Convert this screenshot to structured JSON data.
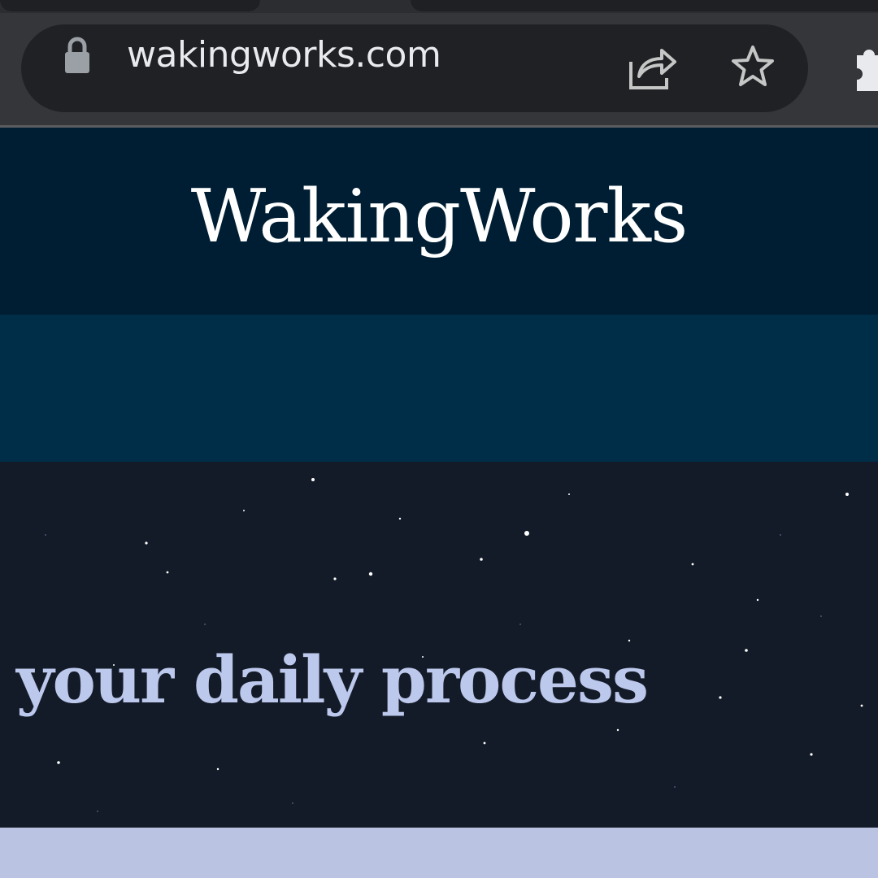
{
  "browser": {
    "address_bar": {
      "url": "wakingworks.com",
      "lock_icon": "lock-icon",
      "share_icon": "share-icon",
      "bookmark_icon": "star-icon"
    },
    "extensions_icon": "puzzle-icon"
  },
  "site": {
    "title": "WakingWorks",
    "hero_text": "your daily process"
  },
  "colors": {
    "header_bg": "#001e33",
    "nav_bg": "#002d48",
    "hero_bg": "#141b28",
    "hero_text": "#bcc8ec",
    "footer_band": "#bac4e2"
  }
}
